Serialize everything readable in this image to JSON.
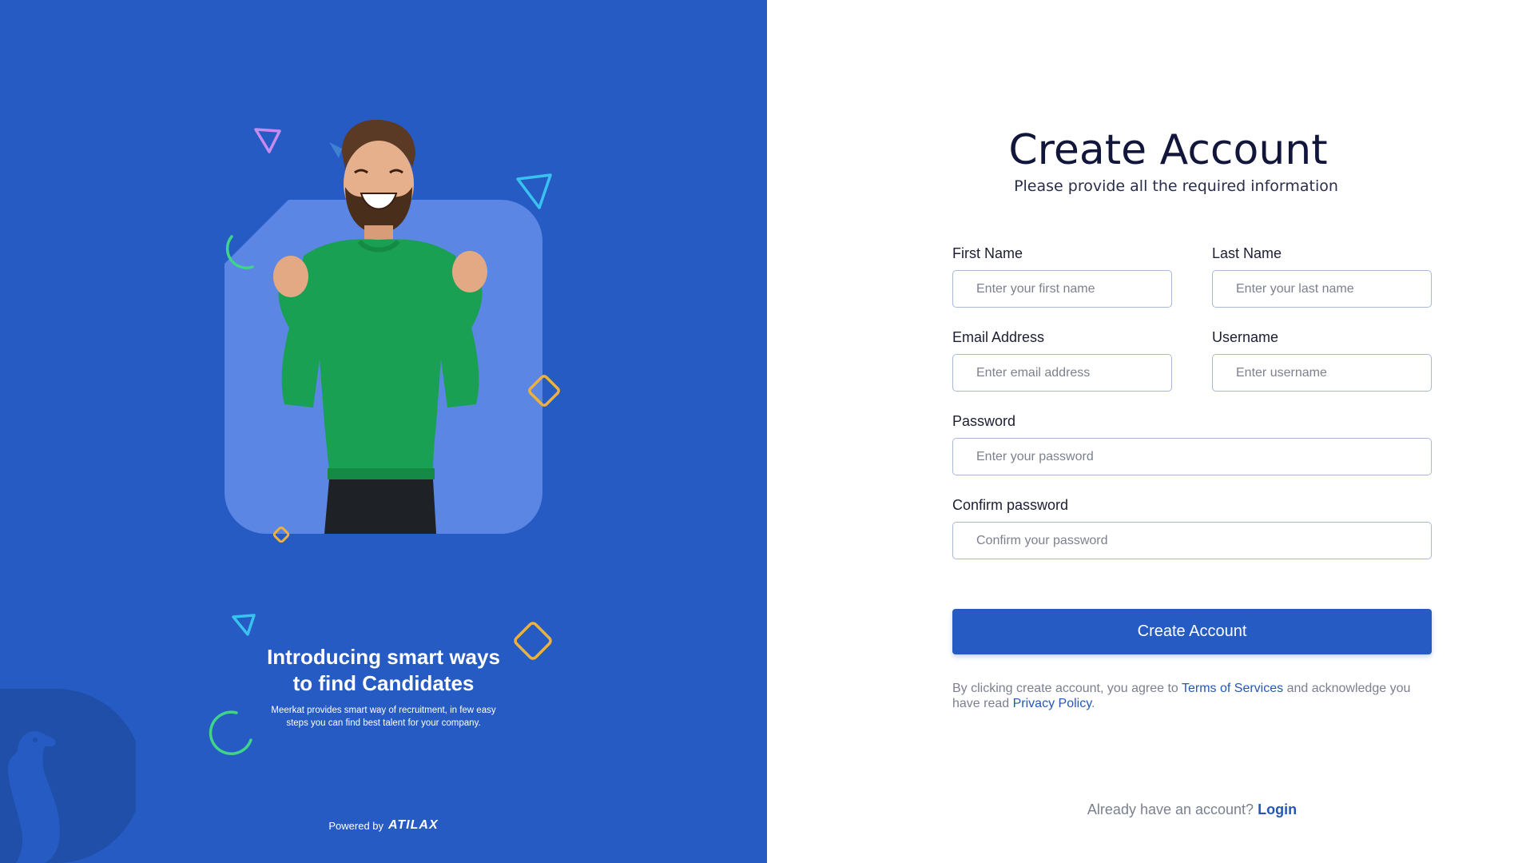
{
  "colors": {
    "primary": "#265bc4",
    "card": "#5b86e4",
    "title": "#12163a",
    "link": "#2457b8",
    "shape_purple": "#c98af0",
    "shape_cyan": "#39c2f0",
    "shape_green": "#3fd48a",
    "shape_orange": "#f0b03c"
  },
  "hero": {
    "heading_line1": "Introducing smart ways",
    "heading_line2": "to find Candidates",
    "subtext_line1": "Meerkat provides smart way of recruitment, in few easy",
    "subtext_line2": "steps you can find best talent for your company.",
    "powered_by": "Powered by",
    "brand": "ATILAX"
  },
  "form": {
    "title": "Create Account",
    "subtitle": "Please provide all the required information",
    "first_name": {
      "label": "First Name",
      "placeholder": "Enter your first name"
    },
    "last_name": {
      "label": "Last Name",
      "placeholder": "Enter your last name"
    },
    "email": {
      "label": "Email Address",
      "placeholder": "Enter email address"
    },
    "username": {
      "label": "Username",
      "placeholder": "Enter username"
    },
    "password": {
      "label": "Password",
      "placeholder": "Enter your password"
    },
    "confirm_password": {
      "label": "Confirm password",
      "placeholder": "Confirm your password"
    },
    "submit_label": "Create Account",
    "terms_prefix": "By clicking create account, you agree to",
    "terms_link": "Terms of Services",
    "terms_middle": "and acknowledge you have read",
    "privacy_link": "Privacy Policy",
    "terms_suffix": ".",
    "login_prompt": "Already have an account?",
    "login_link": "Login"
  }
}
